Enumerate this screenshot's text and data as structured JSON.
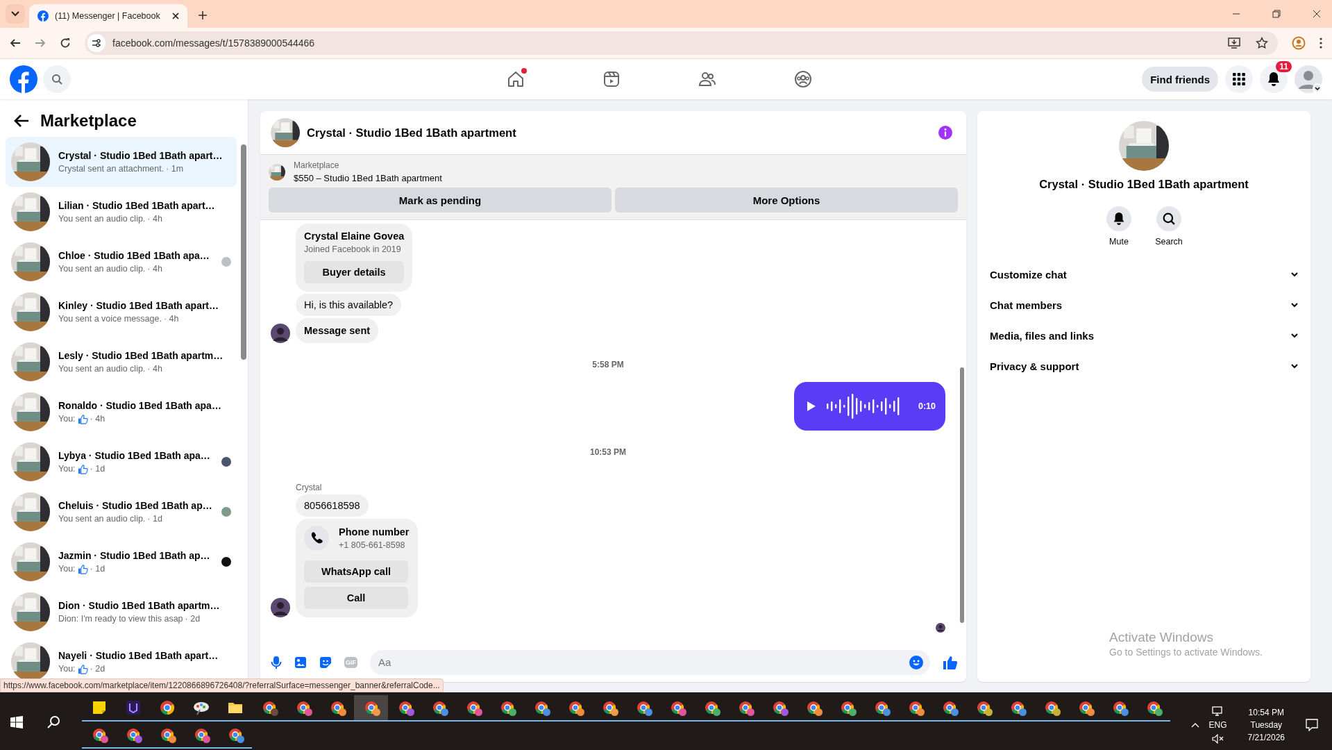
{
  "browser": {
    "tabs": [
      {
        "title": "(11) Messenger | Facebook",
        "selected": true
      }
    ],
    "url": "facebook.com/messages/t/1578389000544466"
  },
  "header": {
    "nav": [
      {
        "kind": "home",
        "selected": false,
        "dot": true
      },
      {
        "kind": "video",
        "selected": false,
        "dot": false
      },
      {
        "kind": "friends",
        "selected": false,
        "dot": false
      },
      {
        "kind": "groups",
        "selected": false,
        "dot": false
      }
    ],
    "find_friends": "Find friends",
    "notifications_badge": "11"
  },
  "sidebar": {
    "title": "Marketplace",
    "items": [
      {
        "title": "Crystal · Studio 1Bed 1Bath apart…",
        "preview": "Crystal sent an attachment.",
        "like": false,
        "time": "· 1m",
        "seen": false,
        "selected": true
      },
      {
        "title": "Lilian · Studio 1Bed 1Bath apart…",
        "preview": "You sent an audio clip.",
        "like": false,
        "time": "· 4h",
        "seen": false,
        "selected": false
      },
      {
        "title": "Chloe · Studio 1Bed 1Bath apa…",
        "preview": "You sent an audio clip.",
        "like": false,
        "time": "· 4h",
        "seen": true,
        "color": "#bcc0c4",
        "selected": false
      },
      {
        "title": "Kinley · Studio 1Bed 1Bath apart…",
        "preview": "You sent a voice message.",
        "like": false,
        "time": "· 4h",
        "seen": false,
        "selected": false
      },
      {
        "title": "Lesly · Studio 1Bed 1Bath apartm…",
        "preview": "You sent an audio clip.",
        "like": false,
        "time": "· 4h",
        "seen": false,
        "selected": false
      },
      {
        "title": "Ronaldo · Studio 1Bed 1Bath apa…",
        "preview": "You:",
        "like": true,
        "time": "· 4h",
        "seen": false,
        "selected": false
      },
      {
        "title": "Lybya · Studio 1Bed 1Bath apa…",
        "preview": "You:",
        "like": true,
        "time": "· 1d",
        "seen": true,
        "color": "#4a5670",
        "selected": false
      },
      {
        "title": "Cheluis · Studio 1Bed 1Bath ap…",
        "preview": "You sent an audio clip.",
        "like": false,
        "time": "· 1d",
        "seen": true,
        "color": "#7f9a8a",
        "selected": false
      },
      {
        "title": "Jazmin · Studio 1Bed 1Bath ap…",
        "preview": "You:",
        "like": true,
        "time": "· 1d",
        "seen": true,
        "color": "#111111",
        "selected": false
      },
      {
        "title": "Dion · Studio 1Bed 1Bath apartm…",
        "preview": "Dion: I'm ready to view this asap",
        "like": false,
        "time": "· 2d",
        "seen": false,
        "selected": false
      },
      {
        "title": "Nayeli · Studio 1Bed 1Bath apart…",
        "preview": "You:",
        "like": true,
        "time": "· 2d",
        "seen": false,
        "selected": false
      }
    ]
  },
  "chat": {
    "title": "Crystal · Studio 1Bed 1Bath apartment",
    "listing": {
      "label": "Marketplace",
      "text": "$550 – Studio 1Bed 1Bath apartment",
      "buttons": [
        "Mark as pending",
        "More Options"
      ]
    },
    "messages": [
      {
        "kind": "buyer_card",
        "name": "Crystal Elaine Govea",
        "note": "Joined Facebook in 2019",
        "button": "Buyer details"
      },
      {
        "kind": "text",
        "text": "Hi, is this available?",
        "avatar": false
      },
      {
        "kind": "status",
        "text": "Message sent",
        "avatar": true
      },
      {
        "kind": "time",
        "text": "5:58 PM"
      },
      {
        "kind": "audio",
        "duration": "0:10"
      },
      {
        "kind": "time",
        "text": "10:53 PM"
      },
      {
        "kind": "sender",
        "text": "Crystal"
      },
      {
        "kind": "text",
        "text": "8056618598",
        "avatar": false
      },
      {
        "kind": "phone_card",
        "title": "Phone number",
        "number": "+1 805-661-8598",
        "buttons": [
          "WhatsApp call",
          "Call"
        ],
        "avatar": true
      },
      {
        "kind": "seen"
      }
    ],
    "composer": {
      "gif": "GIF",
      "placeholder": "Aa"
    }
  },
  "details": {
    "title": "Crystal · Studio 1Bed 1Bath apartment",
    "actions": [
      {
        "kind": "mute",
        "label": "Mute"
      },
      {
        "kind": "search",
        "label": "Search"
      }
    ],
    "sections": [
      {
        "label": "Customize chat",
        "expanded": false
      },
      {
        "label": "Chat members",
        "expanded": false
      },
      {
        "label": "Media, files and links",
        "expanded": false
      },
      {
        "label": "Privacy & support",
        "expanded": false
      }
    ]
  },
  "status_link": "https://www.facebook.com/marketplace/item/1220866896726408/?referralSurface=messenger_banner&referralCode...",
  "os_notice": {
    "title": "Activate Windows",
    "subtitle": "Go to Settings to activate Windows."
  },
  "taskbar": {
    "apps": [
      {
        "kind": "sticky_notes",
        "selected": false
      },
      {
        "kind": "app",
        "selected": false
      },
      {
        "kind": "chrome",
        "selected": false
      },
      {
        "kind": "paint",
        "selected": false
      },
      {
        "kind": "folder",
        "selected": false
      },
      {
        "kind": "chrome_profile",
        "color": "#6b4a3a",
        "selected": false
      },
      {
        "kind": "chrome_profile",
        "color": "#e0559a",
        "selected": false
      },
      {
        "kind": "chrome_profile",
        "color": "#f08a3c",
        "selected": false
      },
      {
        "kind": "chrome_profile",
        "color": "#f2994a",
        "selected": true
      },
      {
        "kind": "chrome_profile",
        "color": "#a259d9",
        "selected": false
      },
      {
        "kind": "chrome_profile",
        "color": "#4a8fe0",
        "selected": false
      },
      {
        "kind": "chrome_profile",
        "color": "#e0559a",
        "selected": false
      },
      {
        "kind": "chrome_profile",
        "color": "#4caf6a",
        "selected": false
      },
      {
        "kind": "chrome_profile",
        "color": "#4a8fe0",
        "selected": false
      },
      {
        "kind": "chrome_profile",
        "color": "#f08a3c",
        "selected": false
      },
      {
        "kind": "chrome_profile",
        "color": "#f2994a",
        "selected": false
      },
      {
        "kind": "chrome_profile",
        "color": "#4a8fe0",
        "selected": false
      },
      {
        "kind": "chrome_profile",
        "color": "#e0559a",
        "selected": false
      },
      {
        "kind": "chrome_profile",
        "color": "#4caf6a",
        "selected": false
      },
      {
        "kind": "chrome_profile",
        "color": "#e0559a",
        "selected": false
      },
      {
        "kind": "chrome_profile",
        "color": "#a259d9",
        "selected": false
      },
      {
        "kind": "chrome_profile",
        "color": "#f08a3c",
        "selected": false
      },
      {
        "kind": "chrome_profile",
        "color": "#4caf6a",
        "selected": false
      },
      {
        "kind": "chrome_profile",
        "color": "#4a8fe0",
        "selected": false
      },
      {
        "kind": "chrome_profile",
        "color": "#f08a3c",
        "selected": false
      },
      {
        "kind": "chrome_profile",
        "color": "#4a8fe0",
        "selected": false
      },
      {
        "kind": "chrome_profile",
        "color": "#c9b23a",
        "selected": false
      },
      {
        "kind": "chrome_profile",
        "color": "#4a8fe0",
        "selected": false
      },
      {
        "kind": "chrome_profile",
        "color": "#c9b23a",
        "selected": false
      },
      {
        "kind": "chrome_profile",
        "color": "#f08a3c",
        "selected": false
      },
      {
        "kind": "chrome_profile",
        "color": "#4a8fe0",
        "selected": false
      },
      {
        "kind": "chrome_profile",
        "color": "#4caf6a",
        "selected": false
      },
      {
        "kind": "chrome_profile",
        "color": "#e0559a",
        "selected": false
      },
      {
        "kind": "chrome_profile",
        "color": "#a259d9",
        "selected": false
      },
      {
        "kind": "chrome_profile",
        "color": "#f08a3c",
        "selected": false
      },
      {
        "kind": "chrome_profile",
        "color": "#e0559a",
        "selected": false
      },
      {
        "kind": "chrome_profile",
        "color": "#4a8fe0",
        "selected": false
      }
    ],
    "language": "ENG",
    "time": "10:54 PM",
    "day": "Tuesday",
    "date": "7/21/2026"
  }
}
